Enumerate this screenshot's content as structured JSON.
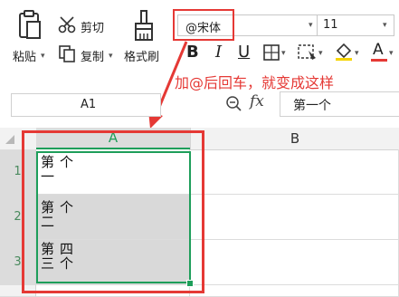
{
  "ribbon": {
    "paste_label": "粘贴",
    "cut_label": "剪切",
    "copy_label": "复制",
    "format_painter_label": "格式刷",
    "font_name": "@宋体",
    "font_size": "11",
    "bold": "B",
    "italic": "I",
    "underline": "U",
    "font_color_letter": "A"
  },
  "annotation": {
    "text": "加@后回车，就变成这样",
    "color": "#e53935"
  },
  "formula_bar": {
    "name_box": "A1",
    "fx": "fx",
    "content": "第一个"
  },
  "columns": [
    "A",
    "B"
  ],
  "rows": [
    {
      "num": "1",
      "text": "第一个"
    },
    {
      "num": "2",
      "text": "第二个"
    },
    {
      "num": "3",
      "text": "第三四个"
    }
  ],
  "colors": {
    "accent": "#1e9e5a",
    "highlight_red": "#e53935",
    "font_color_bar": "#e53935"
  }
}
